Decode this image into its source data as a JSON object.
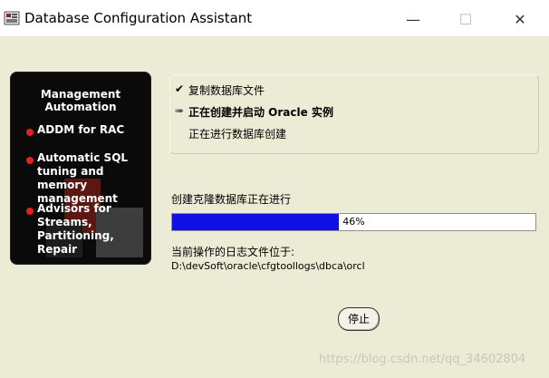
{
  "window": {
    "title": "Database Configuration Assistant",
    "minimize_glyph": "—",
    "maximize_glyph": "☐",
    "close_glyph": "✕"
  },
  "left_panel": {
    "heading_line1": "Management",
    "heading_line2": "Automation",
    "bullets": [
      {
        "lines": [
          "ADDM for RAC"
        ]
      },
      {
        "lines": [
          "Automatic SQL",
          "tuning and memory",
          "management"
        ]
      },
      {
        "lines": [
          "Advisors for",
          "Streams,",
          "Partitioning, Repair"
        ]
      }
    ]
  },
  "steps": [
    {
      "icon": "checkmark-icon",
      "icon_glyph": "✔",
      "label": "复制数据库文件",
      "active": false
    },
    {
      "icon": "running-arrow-icon",
      "icon_glyph": "➠",
      "label": "正在创建并启动 Oracle 实例",
      "active": true
    },
    {
      "icon": "",
      "icon_glyph": "",
      "label": "正在进行数据库创建",
      "active": false
    }
  ],
  "progress": {
    "label": "创建克隆数据库正在进行",
    "percent": 46,
    "percent_text": "46%"
  },
  "log": {
    "label": "当前操作的日志文件位于:",
    "path": "D:\\devSoft\\oracle\\cfgtoollogs\\dbca\\orcl"
  },
  "buttons": {
    "stop_label": "停止"
  },
  "watermark": "https://blog.csdn.net/qq_34602804",
  "colors": {
    "background": "#ecebd6",
    "progress_fill": "#1010e6",
    "bullet": "#e52020"
  }
}
